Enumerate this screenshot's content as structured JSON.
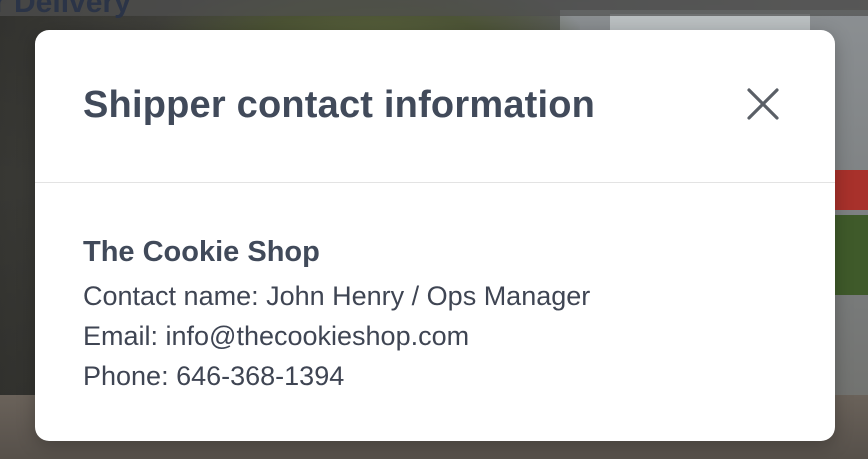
{
  "background": {
    "heading_fragment": "r Delivery"
  },
  "modal": {
    "title": "Shipper contact information",
    "close_icon": "close-icon",
    "company_name": "The Cookie Shop",
    "contact_name_line": "Contact name: John Henry / Ops Manager",
    "email_line": "Email: info@thecookieshop.com",
    "phone_line": "Phone: 646-368-1394"
  },
  "colors": {
    "title_text": "#414a5a",
    "body_text": "#3f4553",
    "modal_bg": "#ffffff",
    "divider": "#e3e3e3"
  }
}
